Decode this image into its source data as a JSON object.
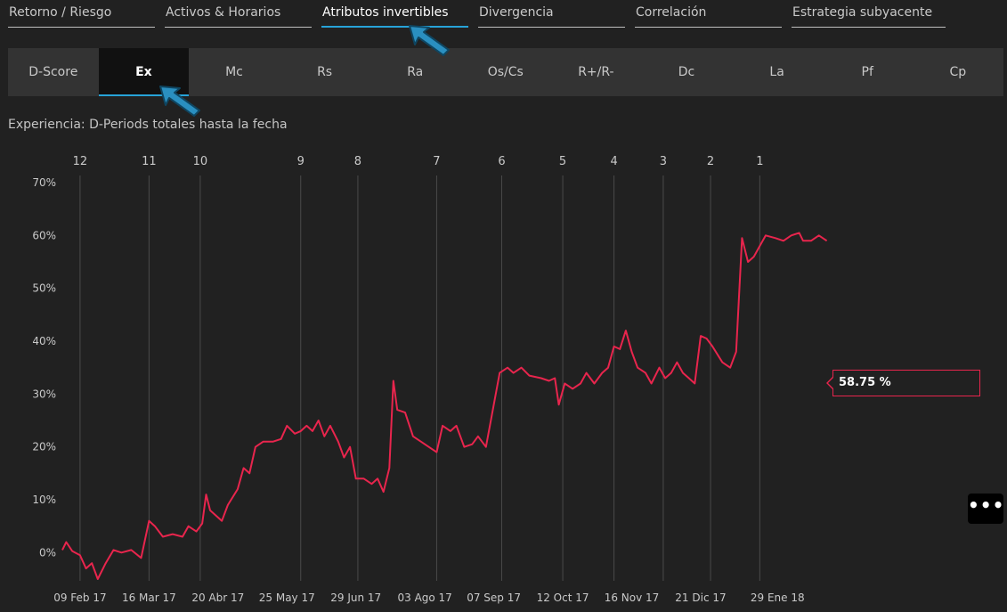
{
  "top_tabs": [
    {
      "label": "Retorno / Riesgo",
      "active": false
    },
    {
      "label": "Activos & Horarios",
      "active": false
    },
    {
      "label": "Atributos invertibles",
      "active": true
    },
    {
      "label": "Divergencia",
      "active": false
    },
    {
      "label": "Correlación",
      "active": false
    },
    {
      "label": "Estrategia subyacente",
      "active": false
    }
  ],
  "sub_tabs": [
    {
      "label": "D-Score",
      "active": false
    },
    {
      "label": "Ex",
      "active": true
    },
    {
      "label": "Mc",
      "active": false
    },
    {
      "label": "Rs",
      "active": false
    },
    {
      "label": "Ra",
      "active": false
    },
    {
      "label": "Os/Cs",
      "active": false
    },
    {
      "label": "R+/R-",
      "active": false
    },
    {
      "label": "Dc",
      "active": false
    },
    {
      "label": "La",
      "active": false
    },
    {
      "label": "Pf",
      "active": false
    },
    {
      "label": "Cp",
      "active": false
    }
  ],
  "subtitle": "Experiencia: D-Periods totales hasta la fecha",
  "current_value": "58.75 %",
  "more_label": "•••",
  "colors": {
    "line": "#e8254d",
    "accent": "#27a3d8",
    "background": "#212121"
  },
  "chart_data": {
    "type": "line",
    "x_unit": "date",
    "y_unit": "percent",
    "ylim": [
      -5,
      70
    ],
    "xlim": [
      "2017-01-31",
      "2018-02-25"
    ],
    "y_ticks": [
      0,
      10,
      20,
      30,
      40,
      50,
      60,
      70
    ],
    "y_tick_labels": [
      "0%",
      "10%",
      "20%",
      "30%",
      "40%",
      "50%",
      "60%",
      "70%"
    ],
    "x_ticks": [
      "2017-02-09",
      "2017-03-16",
      "2017-04-20",
      "2017-05-25",
      "2017-06-29",
      "2017-08-03",
      "2017-09-07",
      "2017-10-12",
      "2017-11-16",
      "2017-12-21",
      "2018-01-29"
    ],
    "x_tick_labels": [
      "09 Feb 17",
      "16 Mar 17",
      "20 Abr 17",
      "25 May 17",
      "29 Jun 17",
      "03 Ago 17",
      "07 Sep 17",
      "12 Oct 17",
      "16 Nov 17",
      "21 Dic 17",
      "29 Ene 18"
    ],
    "period_markers": [
      {
        "label": "12",
        "date": "2017-02-09"
      },
      {
        "label": "11",
        "date": "2017-03-16"
      },
      {
        "label": "10",
        "date": "2017-04-11"
      },
      {
        "label": "9",
        "date": "2017-06-01"
      },
      {
        "label": "8",
        "date": "2017-06-30"
      },
      {
        "label": "7",
        "date": "2017-08-09"
      },
      {
        "label": "6",
        "date": "2017-09-11"
      },
      {
        "label": "5",
        "date": "2017-10-12"
      },
      {
        "label": "4",
        "date": "2017-11-07"
      },
      {
        "label": "3",
        "date": "2017-12-02"
      },
      {
        "label": "2",
        "date": "2017-12-26"
      },
      {
        "label": "1",
        "date": "2018-01-20"
      }
    ],
    "series": [
      {
        "values": [
          [
            "2017-01-31",
            0.5
          ],
          [
            "2017-02-02",
            2.0
          ],
          [
            "2017-02-05",
            0.3
          ],
          [
            "2017-02-09",
            -0.5
          ],
          [
            "2017-02-12",
            -3.0
          ],
          [
            "2017-02-15",
            -2.0
          ],
          [
            "2017-02-18",
            -5.0
          ],
          [
            "2017-02-22",
            -2.0
          ],
          [
            "2017-02-26",
            0.5
          ],
          [
            "2017-03-02",
            0.0
          ],
          [
            "2017-03-07",
            0.5
          ],
          [
            "2017-03-12",
            -1.0
          ],
          [
            "2017-03-16",
            6.0
          ],
          [
            "2017-03-19",
            5.0
          ],
          [
            "2017-03-23",
            3.0
          ],
          [
            "2017-03-28",
            3.5
          ],
          [
            "2017-04-02",
            3.0
          ],
          [
            "2017-04-05",
            5.0
          ],
          [
            "2017-04-09",
            4.0
          ],
          [
            "2017-04-12",
            5.5
          ],
          [
            "2017-04-14",
            11.0
          ],
          [
            "2017-04-16",
            8.0
          ],
          [
            "2017-04-22",
            6.0
          ],
          [
            "2017-04-25",
            9.0
          ],
          [
            "2017-04-30",
            12.0
          ],
          [
            "2017-05-03",
            16.0
          ],
          [
            "2017-05-06",
            15.0
          ],
          [
            "2017-05-09",
            20.0
          ],
          [
            "2017-05-13",
            21.0
          ],
          [
            "2017-05-18",
            21.0
          ],
          [
            "2017-05-22",
            21.5
          ],
          [
            "2017-05-25",
            24.0
          ],
          [
            "2017-05-29",
            22.5
          ],
          [
            "2017-06-01",
            23.0
          ],
          [
            "2017-06-04",
            24.0
          ],
          [
            "2017-06-07",
            23.0
          ],
          [
            "2017-06-10",
            25.0
          ],
          [
            "2017-06-13",
            22.0
          ],
          [
            "2017-06-16",
            24.0
          ],
          [
            "2017-06-20",
            21.0
          ],
          [
            "2017-06-23",
            18.0
          ],
          [
            "2017-06-26",
            20.0
          ],
          [
            "2017-06-29",
            14.0
          ],
          [
            "2017-07-03",
            14.0
          ],
          [
            "2017-07-07",
            13.0
          ],
          [
            "2017-07-10",
            14.0
          ],
          [
            "2017-07-13",
            11.5
          ],
          [
            "2017-07-16",
            16.0
          ],
          [
            "2017-07-18",
            32.5
          ],
          [
            "2017-07-20",
            27.0
          ],
          [
            "2017-07-24",
            26.5
          ],
          [
            "2017-07-28",
            22.0
          ],
          [
            "2017-08-01",
            21.0
          ],
          [
            "2017-08-05",
            20.0
          ],
          [
            "2017-08-09",
            19.0
          ],
          [
            "2017-08-12",
            24.0
          ],
          [
            "2017-08-16",
            23.0
          ],
          [
            "2017-08-19",
            24.0
          ],
          [
            "2017-08-23",
            20.0
          ],
          [
            "2017-08-27",
            20.5
          ],
          [
            "2017-08-30",
            22.0
          ],
          [
            "2017-09-03",
            20.0
          ],
          [
            "2017-09-07",
            28.0
          ],
          [
            "2017-09-10",
            34.0
          ],
          [
            "2017-09-14",
            35.0
          ],
          [
            "2017-09-17",
            34.0
          ],
          [
            "2017-09-21",
            35.0
          ],
          [
            "2017-09-25",
            33.5
          ],
          [
            "2017-10-01",
            33.0
          ],
          [
            "2017-10-05",
            32.5
          ],
          [
            "2017-10-08",
            33.0
          ],
          [
            "2017-10-10",
            28.0
          ],
          [
            "2017-10-13",
            32.0
          ],
          [
            "2017-10-17",
            31.0
          ],
          [
            "2017-10-21",
            32.0
          ],
          [
            "2017-10-24",
            34.0
          ],
          [
            "2017-10-28",
            32.0
          ],
          [
            "2017-11-01",
            34.0
          ],
          [
            "2017-11-04",
            35.0
          ],
          [
            "2017-11-07",
            39.0
          ],
          [
            "2017-11-10",
            38.5
          ],
          [
            "2017-11-13",
            42.0
          ],
          [
            "2017-11-16",
            38.0
          ],
          [
            "2017-11-19",
            35.0
          ],
          [
            "2017-11-23",
            34.0
          ],
          [
            "2017-11-26",
            32.0
          ],
          [
            "2017-11-30",
            35.0
          ],
          [
            "2017-12-03",
            33.0
          ],
          [
            "2017-12-06",
            34.0
          ],
          [
            "2017-12-09",
            36.0
          ],
          [
            "2017-12-12",
            34.0
          ],
          [
            "2017-12-15",
            33.0
          ],
          [
            "2017-12-18",
            32.0
          ],
          [
            "2017-12-21",
            41.0
          ],
          [
            "2017-12-24",
            40.5
          ],
          [
            "2017-12-27",
            39.0
          ],
          [
            "2018-01-01",
            36.0
          ],
          [
            "2018-01-05",
            35.0
          ],
          [
            "2018-01-08",
            38.0
          ],
          [
            "2018-01-11",
            59.5
          ],
          [
            "2018-01-14",
            55.0
          ],
          [
            "2018-01-17",
            56.0
          ],
          [
            "2018-01-20",
            58.0
          ],
          [
            "2018-01-23",
            60.0
          ],
          [
            "2018-01-28",
            59.5
          ],
          [
            "2018-02-01",
            59.0
          ],
          [
            "2018-02-05",
            60.0
          ],
          [
            "2018-02-09",
            60.5
          ],
          [
            "2018-02-11",
            59.0
          ],
          [
            "2018-02-15",
            59.0
          ],
          [
            "2018-02-19",
            60.0
          ],
          [
            "2018-02-23",
            59.0
          ]
        ]
      }
    ]
  }
}
